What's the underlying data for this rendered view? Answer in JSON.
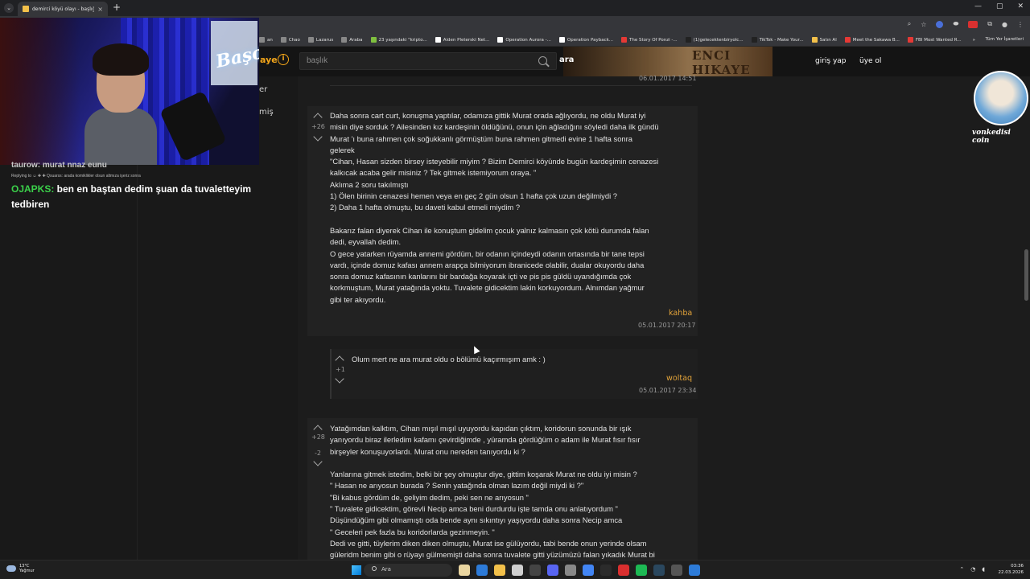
{
  "browser": {
    "tab_title": "demirci köyü olayı - başlığı açan...",
    "new_tab_symbol": "+",
    "tab_list_symbol": "⌄",
    "tab_close_symbol": "×",
    "window_controls": [
      "—",
      "▢",
      "✕"
    ],
    "bookmarks": [
      {
        "label": "an",
        "color": "#888888"
      },
      {
        "label": "Chao",
        "color": "#888888"
      },
      {
        "label": "Lazarus",
        "color": "#888888"
      },
      {
        "label": "Araba",
        "color": "#888888"
      },
      {
        "label": "23 yaşındaki \"kripto...",
        "color": "#7fbf3f"
      },
      {
        "label": "Aiden Pleterski Net...",
        "color": "#ffffff"
      },
      {
        "label": "Operation Aurora -...",
        "color": "#ffffff"
      },
      {
        "label": "Operation Payback...",
        "color": "#ffffff"
      },
      {
        "label": "The Story Of Ponzi -...",
        "color": "#e53935"
      },
      {
        "label": "(1)gelecektenbiryolc...",
        "color": "#222222"
      },
      {
        "label": "TikTok - Make Your...",
        "color": "#222222"
      },
      {
        "label": "Satın Al",
        "color": "#f2c04a"
      },
      {
        "label": "Meet the Sakawa B...",
        "color": "#e53935"
      },
      {
        "label": "FBI Most Wanted R...",
        "color": "#e53935"
      }
    ],
    "bookmarks_more": "»",
    "all_bookmarks": "Tüm Yer İşaretleri"
  },
  "site": {
    "logo_fragment": "aye",
    "search_placeholder": "başlık",
    "search_button": "ara",
    "login": "giriş yap",
    "signup": "üye ol",
    "banner_text": "ENCI HIKAYE",
    "accent": "#f2a51a"
  },
  "left_panel": {
    "items": [
      "er",
      "miş"
    ]
  },
  "entries": {
    "prev_date": "06.01.2017 14:51",
    "e1": {
      "score": "+26",
      "text": "Daha sonra cart curt, konuşma yaptılar, odamıza gittik Murat orada ağlıyordu, ne oldu Murat iyi\nmisin diye sorduk ? Ailesinden kız kardeşinin öldüğünü, onun için ağladığını söyledi daha ilk gündü\nMurat 'ı buna rahmen çok soğukkanlı görmüştüm buna rahmen gitmedi evine 1 hafta sonra\ngelerek\n\"Cihan, Hasan sizden birsey isteyebilir miyim ? Bizim Demirci köyünde bugün kardeşimin cenazesi\nkalkıcak acaba gelir misiniz ? Tek gitmek istemiyorum oraya. \"\nAklıma 2 soru takılmıştı\n1) Ölen birinin cenazesi hemen veya en geç 2 gün olsun 1 hafta çok uzun değilmiydi ?\n2) Daha 1 hafta olmuştu, bu daveti kabul etmeli miydim ?\n\nBakarız falan diyerek Cihan ile konuştum gidelim çocuk yalnız kalmasın çok kötü durumda falan\ndedi, eyvallah dedim.\nO gece yatarken rüyamda annemi gördüm, bir odanın içindeydi odanın ortasında bir tane tepsi\nvardı, içinde domuz kafası annem arapça bilmiyorum ibranicede olabilir, dualar okuyordu daha\nsonra domuz kafasının kanlarını bir bardağa koyarak içti ve pis pis güldü uyandığımda çok\nkorkmuştum, Murat yatağında yoktu. Tuvalete gidicektim lakin korkuyordum. Alnımdan yağmur\ngibi ter akıyordu.",
      "author": "kahba",
      "date": "05.01.2017 20:17"
    },
    "e2": {
      "score": "+1",
      "text": "Olum mert ne ara murat oldu o bölümü kaçırmışım amk : )",
      "author": "woltaq",
      "date": "05.01.2017 23:34"
    },
    "e3": {
      "score_up": "+28",
      "score_down": "-2",
      "text": "Yatağımdan kalktım, Cihan mışıl mışıl uyuyordu kapıdan çıktım, koridorun sonunda bir ışık\nyanıyordu biraz ilerledim kafamı çevirdiğimde , yüramda gördüğüm o adam ile Murat fısır fısır\nbirşeyler konuşuyorlardı. Murat onu nereden tanıyordu ki ?\n\nYanlarına gitmek istedim, belki bir şey olmuştur diye, gittim koşarak Murat ne oldu iyi misin ?\n\" Hasan ne arıyosun burada ? Senin yatağında olman lazım değil miydi ki ?\"\n\"Bi kabus gördüm de, geliyim dedim, peki sen ne arıyosun \"\n\" Tuvalete gidicektim, görevli Necip amca beni durdurdu işte tamda onu anlatıyordum \"\nDüşündüğüm gibi olmamıştı oda bende aynı sıkıntıyı yaşıyordu daha sonra Necip amca\n\" Geceleri pek fazla bu koridorlarda gezinmeyin. \"\nDedi ve gitti, tüylerim diken diken olmuştu, Murat ise gülüyordu, tabi bende onun yerinde olsam\ngüleridm benim gibi o rüyayı gülmemişti daha sonra tuvalete gitti yüzümüzü falan yıkadık Murat bi"
    }
  },
  "stream": {
    "neon_sign": "Başo",
    "chat_prev_user": "taurow:",
    "chat_prev_text": "murat nnaz eunu",
    "chat_reply_line": "Replying to ☺ ✚ ✚ Qsuarss: arada komiklikler olsun altmıza işeriz sonra",
    "chat_user": "OJAPKS:",
    "chat_text": " ben en baştan dedim şuan da tuvaletteyim tedbiren",
    "badge_label": "vonkedisi coin"
  },
  "taskbar": {
    "weather_temp": "13°C",
    "weather_desc": "Yağmur",
    "search_label": "Ara",
    "time": "03:36",
    "date": "22.03.2026",
    "apps": [
      "#e9d5a0",
      "#2d7bd8",
      "#f2c04a",
      "#cfcfcf",
      "#444444",
      "#5865f2",
      "#888888",
      "#4285f4",
      "#2b2b2b",
      "#d92f2f",
      "#1db954",
      "#2a475e",
      "#555555",
      "#2d7bd8"
    ]
  }
}
